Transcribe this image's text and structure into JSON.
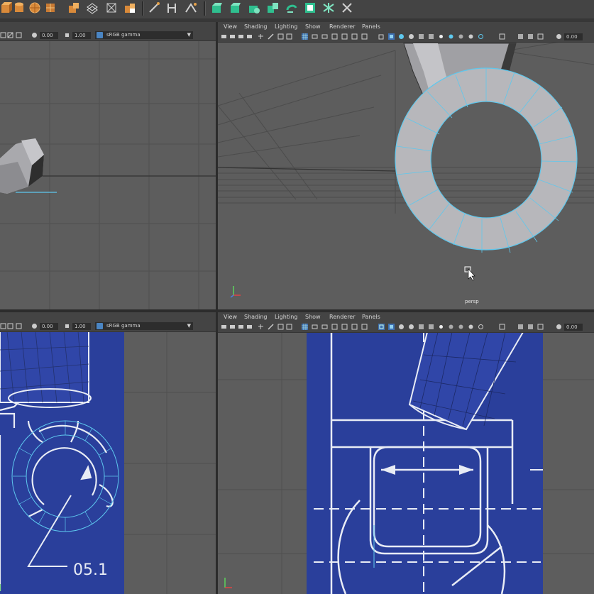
{
  "shelf": {
    "icons": [
      "cube-orange-icon",
      "poly-cylinder-icon",
      "sphere-icon",
      "poly-plane-icon",
      "sweep-icon",
      "lattice-icon",
      "cluster-icon",
      "sculpt-brush-icon",
      "ik-handle-icon",
      "joint-tool-icon",
      "skin-bind-icon",
      "poly-extrude-icon",
      "poly-bevel-icon",
      "poly-bridge-icon",
      "poly-combine-icon",
      "poly-mirror-icon",
      "poly-reduce-icon",
      "multicut-icon",
      "target-weld-icon"
    ]
  },
  "viewport_menu": [
    "View",
    "Shading",
    "Lighting",
    "Show",
    "Renderer",
    "Panels"
  ],
  "left_top": {
    "val1": "0.00",
    "val2": "1.00",
    "colorspace": "sRGB gamma"
  },
  "left_bottom": {
    "val1": "0.00",
    "val2": "1.00",
    "colorspace": "sRGB gamma"
  },
  "right_top": {
    "val1": "0.00",
    "camera_label": "persp"
  },
  "right_bottom": {
    "val1": "0.00"
  },
  "blueprint": {
    "dimension_text": "05.1"
  },
  "colors": {
    "viewport_bg": "#5d5d5d",
    "blueprint_blue": "#2a3f9b",
    "selection_cyan": "#5ec8ee",
    "mesh_grey": "#b4b4b8"
  }
}
